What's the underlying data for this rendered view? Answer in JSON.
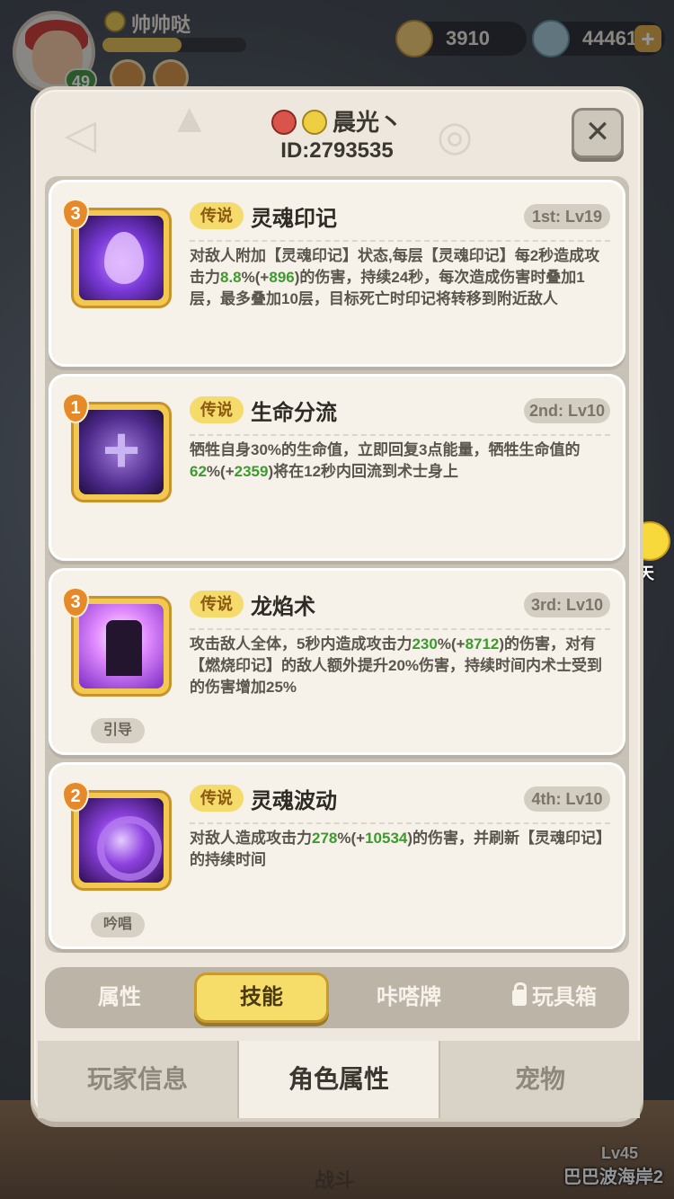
{
  "hud": {
    "player_name": "帅帅哒",
    "level": "49",
    "currency_shells": "3910",
    "currency_gems": "44461",
    "plus": "+",
    "chat_label": "聊天",
    "battle_label": "战斗",
    "zone_level": "Lv45",
    "zone_name": "巴巴波海岸2"
  },
  "modal": {
    "player_display": "晨光丶",
    "player_id": "ID:2793535",
    "close_label": "✕"
  },
  "skills": [
    {
      "rank": "3",
      "rarity": "传说",
      "name": "灵魂印记",
      "slot": "1st: Lv19",
      "type": "",
      "desc_parts": [
        "对敌人附加【灵魂印记】状态,每层【灵魂印记】每2秒造成攻击力",
        "8.8",
        "%(+",
        "896",
        ")的伤害，持续24秒，每次造成伤害时叠加1层，最多叠加10层，目标死亡时印记将转移到附近敌人"
      ]
    },
    {
      "rank": "1",
      "rarity": "传说",
      "name": "生命分流",
      "slot": "2nd: Lv10",
      "type": "",
      "desc_parts": [
        "牺牲自身30%的生命值，立即回复3点能量，牺牲生命值的",
        "62",
        "%(+",
        "2359",
        ")将在12秒内回流到术士身上"
      ]
    },
    {
      "rank": "3",
      "rarity": "传说",
      "name": "龙焰术",
      "slot": "3rd: Lv10",
      "type": "引导",
      "desc_parts": [
        "攻击敌人全体，5秒内造成攻击力",
        "230",
        "%(+",
        "8712",
        ")的伤害，对有【燃烧印记】的敌人额外提升20%伤害，持续时间内术士受到的伤害增加25%"
      ]
    },
    {
      "rank": "2",
      "rarity": "传说",
      "name": "灵魂波动",
      "slot": "4th: Lv10",
      "type": "吟唱",
      "desc_parts": [
        "对敌人造成攻击力",
        "278",
        "%(+",
        "10534",
        ")的伤害，并刷新【灵魂印记】的持续时间"
      ]
    }
  ],
  "subtabs": [
    "属性",
    "技能",
    "咔嗒牌",
    "玩具箱"
  ],
  "bottomtabs": [
    "玩家信息",
    "角色属性",
    "宠物"
  ],
  "colors": {
    "highlight_green": "#3d9a2e",
    "rarity_gold": "#f5da6c",
    "active_tab": "#f6dd6a"
  }
}
